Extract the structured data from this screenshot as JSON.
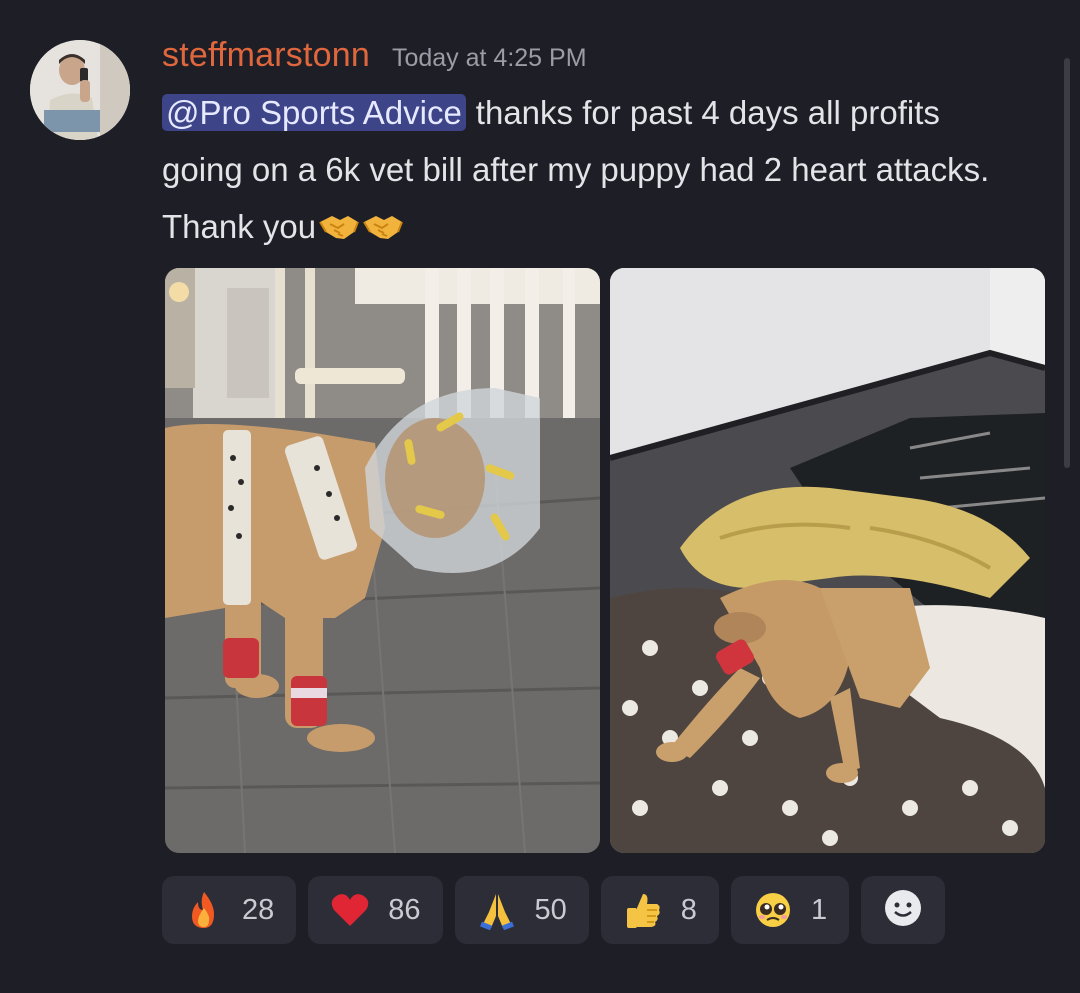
{
  "message": {
    "username": "steffmarstonn",
    "timestamp": "Today at 4:25 PM",
    "mention": "@Pro Sports Advice",
    "text": "thanks for past 4 days all profits going on a 6k vet bill after my puppy had 2 heart attacks. Thank you",
    "inline_emojis": [
      "handshake-emoji",
      "handshake-emoji"
    ]
  },
  "attachments": [
    {
      "icon": "dog-in-cone-photo"
    },
    {
      "icon": "dog-sleeping-photo"
    }
  ],
  "reactions": [
    {
      "icon": "fire-emoji",
      "count": "28"
    },
    {
      "icon": "heart-emoji",
      "count": "86"
    },
    {
      "icon": "pray-emoji",
      "count": "50"
    },
    {
      "icon": "thumbs-up-emoji",
      "count": "8"
    },
    {
      "icon": "pleading-face-emoji",
      "count": "1"
    }
  ],
  "colors": {
    "background": "#1e1f26",
    "username": "#e0673d",
    "mention_bg": "#3d4488",
    "reaction_bg": "#2c2d36"
  }
}
